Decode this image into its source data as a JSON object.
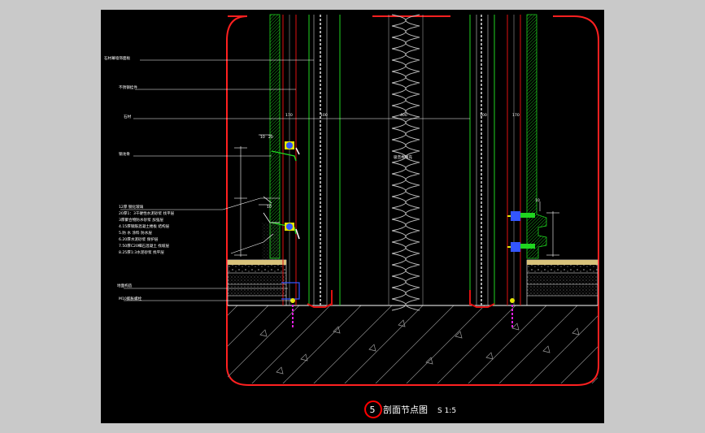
{
  "labels": {
    "l1": "石材幕墙饰面板",
    "l2": "不锈钢挂件",
    "l3": "石材",
    "l4": "钢龙骨",
    "l5": "吸音棉填充",
    "notes": [
      "12厚 钢化玻璃",
      "20厚1：3干硬性水泥砂浆 找平层",
      "3厚聚合物防水砂浆 加强层",
      "4.15厚钢筋混凝土楼板 结构层",
      "5.防 水 涂料 防水层",
      "6.20厚水泥砂浆 保护层",
      "7.50厚C20细石混凝土 找坡层",
      "8.25厚1:3水泥砂浆 找平层"
    ],
    "l6": "地面构造",
    "l7": "M10膨胀螺栓",
    "dims": [
      "170",
      "100",
      "400",
      "100",
      "170"
    ],
    "small_dims": [
      "10",
      "20"
    ]
  },
  "title": {
    "number": "5",
    "text": "剖面节点图",
    "scale": "S 1:5"
  },
  "colors": {
    "background": "#000000",
    "frame": "#ff2020",
    "green": "#1fd51f",
    "red": "#e01010",
    "white": "#ffffff",
    "gray": "#9a9a9a",
    "yellow": "#e6e600",
    "blue": "#3355ff",
    "magenta": "#e020e0",
    "title_circle": "#ff0000"
  }
}
